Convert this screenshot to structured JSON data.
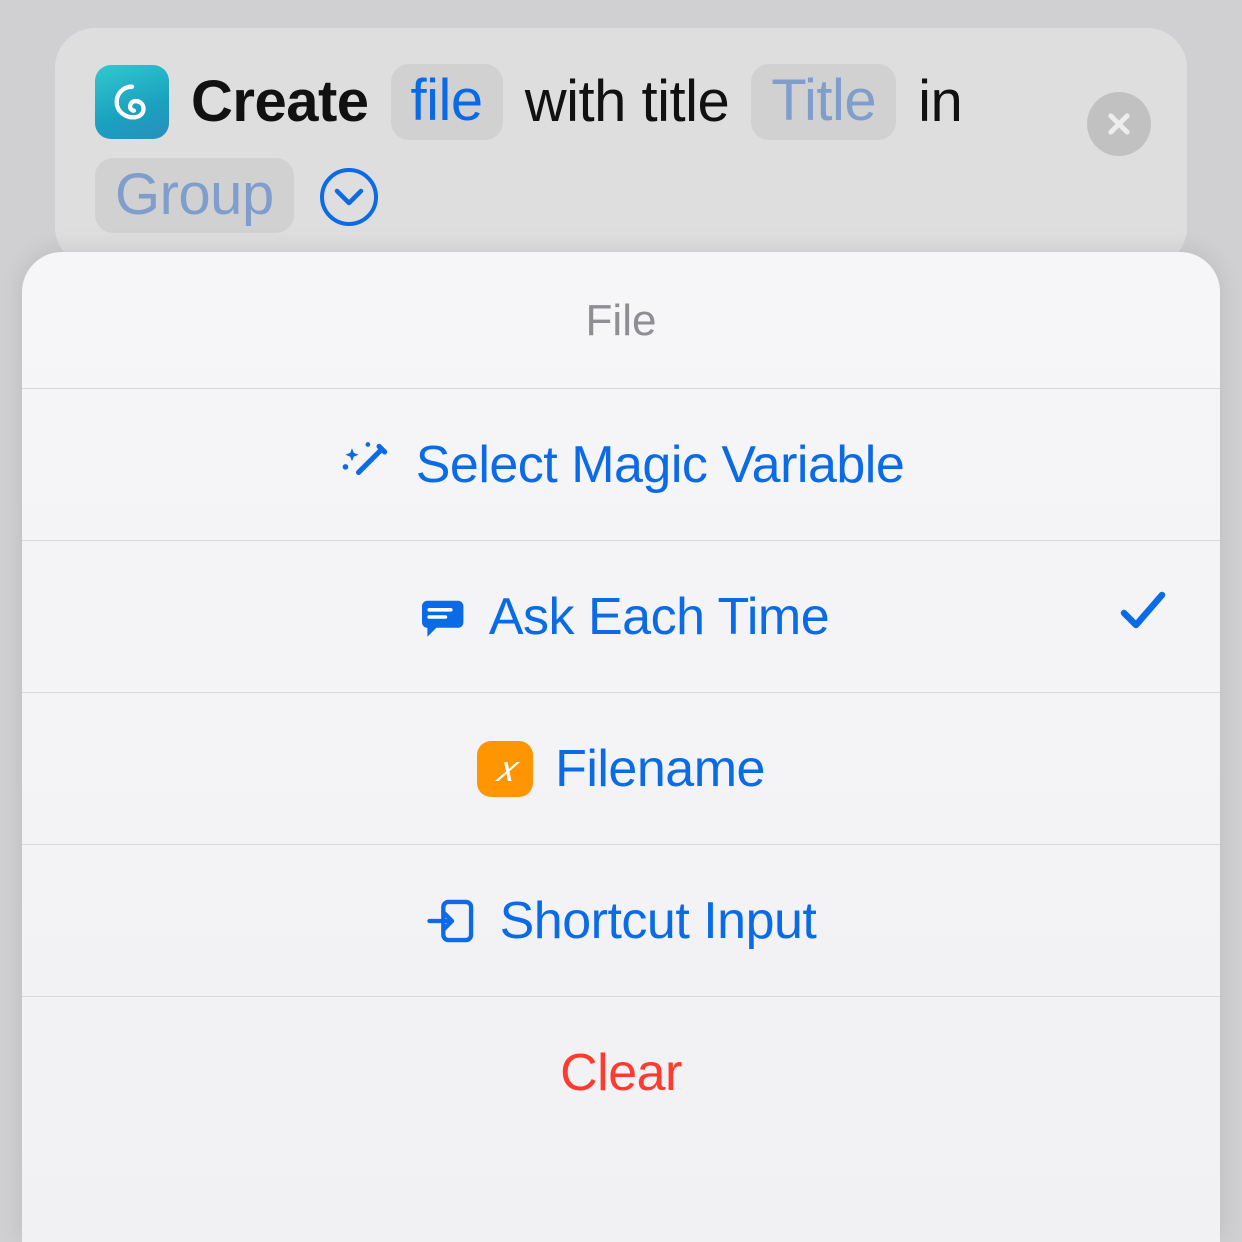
{
  "action": {
    "verb": "Create",
    "param_file": "file",
    "text_with_title": "with title",
    "param_title": "Title",
    "text_in": "in",
    "param_group": "Group"
  },
  "picker": {
    "header": "File",
    "rows": [
      {
        "icon": "magic",
        "label": "Select Magic Variable",
        "selected": false
      },
      {
        "icon": "speech",
        "label": "Ask Each Time",
        "selected": true
      },
      {
        "icon": "xvar",
        "label": "Filename",
        "selected": false
      },
      {
        "icon": "input",
        "label": "Shortcut Input",
        "selected": false
      },
      {
        "icon": "",
        "label": "Clear",
        "selected": false,
        "destructive": true
      }
    ]
  }
}
